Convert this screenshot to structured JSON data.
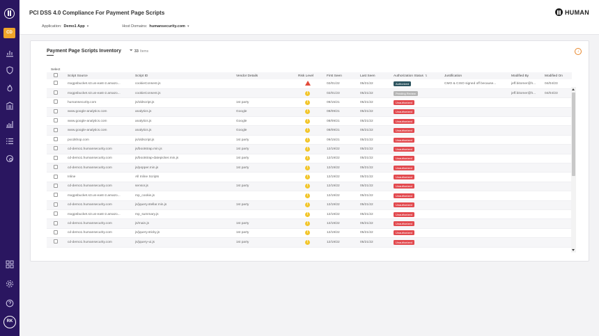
{
  "sidebar": {
    "active_item": "CD",
    "avatar_initials": "RK",
    "items": [
      "chart-icon",
      "shield-icon",
      "fire-icon",
      "bank-icon",
      "bar-chart-icon",
      "list-icon",
      "target-icon"
    ],
    "bottom_items": [
      "grid-icon",
      "gear-icon",
      "help-icon"
    ]
  },
  "header": {
    "title": "PCI DSS 4.0 Compliance For Payment Page Scripts",
    "application_label": "Application:",
    "application_value": "Demo1 App",
    "domains_label": "Host Domains:",
    "domains_value": "humansecurity.com",
    "brand": "HUMAN"
  },
  "card": {
    "title": "Payment Page Scripts Inventory",
    "count": "33",
    "count_label": "Items"
  },
  "table": {
    "select_label": "Select",
    "columns": [
      "Script Source",
      "Script ID",
      "Vendor Details",
      "Risk Level",
      "First Seen",
      "Last Seen",
      "Authorization Status",
      "Justification",
      "Modified By",
      "Modified On"
    ],
    "rows": [
      {
        "source": "mxgpsbucket.s3.us-east-2.amazo...",
        "id": "cookieConsent.js",
        "vendor": "",
        "risk": "high",
        "first": "02/01/22",
        "last": "05/21/22",
        "status": "Authorized",
        "status_type": "authorized",
        "justification": "CMO & CISO signed off because...",
        "modified_by": "jeff.bitomer@h...",
        "modified_on": "04/04/23"
      },
      {
        "source": "mxgpsbucket.s3.us-east-2.amazo...",
        "id": "cookieConsent.js",
        "vendor": "",
        "risk": "warn",
        "first": "02/01/23",
        "last": "05/21/22",
        "status": "Pending Review",
        "status_type": "pending",
        "justification": "",
        "modified_by": "jeff.bitomer@h...",
        "modified_on": "04/04/23"
      },
      {
        "source": "humansecurity.com",
        "id": "js/oldscript.js",
        "vendor": "1st party",
        "risk": "warn",
        "first": "09/15/21",
        "last": "05/21/22",
        "status": "Unauthorized",
        "status_type": "unauthorized",
        "justification": "",
        "modified_by": "",
        "modified_on": ""
      },
      {
        "source": "www.google-analytics.com",
        "id": "analytics.js",
        "vendor": "Google",
        "risk": "warn",
        "first": "08/09/21",
        "last": "05/21/22",
        "status": "Unauthorized",
        "status_type": "unauthorized",
        "justification": "",
        "modified_by": "",
        "modified_on": ""
      },
      {
        "source": "www.google-analytics.com",
        "id": "analytics.js",
        "vendor": "Google",
        "risk": "warn",
        "first": "08/09/21",
        "last": "05/21/22",
        "status": "Unauthorized",
        "status_type": "unauthorized",
        "justification": "",
        "modified_by": "",
        "modified_on": ""
      },
      {
        "source": "www.google-analytics.com",
        "id": "analytics.js",
        "vendor": "Google",
        "risk": "warn",
        "first": "08/09/21",
        "last": "05/21/22",
        "status": "Unauthorized",
        "status_type": "unauthorized",
        "justification": "",
        "modified_by": "",
        "modified_on": ""
      },
      {
        "source": "pxcdshop.com",
        "id": "js/oldscript.js",
        "vendor": "1st party",
        "risk": "warn",
        "first": "09/15/21",
        "last": "05/21/22",
        "status": "Unauthorized",
        "status_type": "unauthorized",
        "justification": "",
        "modified_by": "",
        "modified_on": ""
      },
      {
        "source": "cd-demo1.humansecurity.com",
        "id": "js/bootstrap.min.js",
        "vendor": "1st party",
        "risk": "warn",
        "first": "12/19/22",
        "last": "05/21/22",
        "status": "Unauthorized",
        "status_type": "unauthorized",
        "justification": "",
        "modified_by": "",
        "modified_on": ""
      },
      {
        "source": "cd-demo1.humansecurity.com",
        "id": "js/bootstrap-datepicker.min.js",
        "vendor": "1st party",
        "risk": "warn",
        "first": "12/19/22",
        "last": "05/21/22",
        "status": "Unauthorized",
        "status_type": "unauthorized",
        "justification": "",
        "modified_by": "",
        "modified_on": ""
      },
      {
        "source": "cd-demo1.humansecurity.com",
        "id": "js/popper.min.js",
        "vendor": "1st party",
        "risk": "warn",
        "first": "12/19/22",
        "last": "05/21/22",
        "status": "Unauthorized",
        "status_type": "unauthorized",
        "justification": "",
        "modified_by": "",
        "modified_on": ""
      },
      {
        "source": "Inline",
        "id": "All Inline Scripts",
        "vendor": "",
        "risk": "warn",
        "first": "12/19/22",
        "last": "05/21/22",
        "status": "Unauthorized",
        "status_type": "unauthorized",
        "justification": "",
        "modified_by": "",
        "modified_on": ""
      },
      {
        "source": "cd-demo1.humansecurity.com",
        "id": "sensor.js",
        "vendor": "1st party",
        "risk": "warn",
        "first": "12/19/22",
        "last": "05/21/22",
        "status": "Unauthorized",
        "status_type": "unauthorized",
        "justification": "",
        "modified_by": "",
        "modified_on": ""
      },
      {
        "source": "mxgpsbucket.s3.us-east-2.amazo...",
        "id": "mp_cookie.js",
        "vendor": "",
        "risk": "warn",
        "first": "12/19/22",
        "last": "05/21/22",
        "status": "Unauthorized",
        "status_type": "unauthorized",
        "justification": "",
        "modified_by": "",
        "modified_on": ""
      },
      {
        "source": "cd-demo1.humansecurity.com",
        "id": "js/jquery.stellar.min.js",
        "vendor": "1st party",
        "risk": "warn",
        "first": "12/19/22",
        "last": "05/21/22",
        "status": "Unauthorized",
        "status_type": "unauthorized",
        "justification": "",
        "modified_by": "",
        "modified_on": ""
      },
      {
        "source": "mxgpsbucket.s3.us-east-2.amazo...",
        "id": "mp_summary.js",
        "vendor": "",
        "risk": "warn",
        "first": "12/19/22",
        "last": "05/21/22",
        "status": "Unauthorized",
        "status_type": "unauthorized",
        "justification": "",
        "modified_by": "",
        "modified_on": ""
      },
      {
        "source": "cd-demo1.humansecurity.com",
        "id": "js/main.js",
        "vendor": "1st party",
        "risk": "warn",
        "first": "12/19/22",
        "last": "05/21/22",
        "status": "Unauthorized",
        "status_type": "unauthorized",
        "justification": "",
        "modified_by": "",
        "modified_on": ""
      },
      {
        "source": "cd-demo1.humansecurity.com",
        "id": "js/jquery.sticky.js",
        "vendor": "1st party",
        "risk": "warn",
        "first": "12/19/22",
        "last": "05/21/22",
        "status": "Unauthorized",
        "status_type": "unauthorized",
        "justification": "",
        "modified_by": "",
        "modified_on": ""
      },
      {
        "source": "cd-demo1.humansecurity.com",
        "id": "js/jquery-ui.js",
        "vendor": "1st party",
        "risk": "warn",
        "first": "12/19/22",
        "last": "05/21/22",
        "status": "Unauthorized",
        "status_type": "unauthorized",
        "justification": "",
        "modified_by": "",
        "modified_on": ""
      }
    ]
  }
}
